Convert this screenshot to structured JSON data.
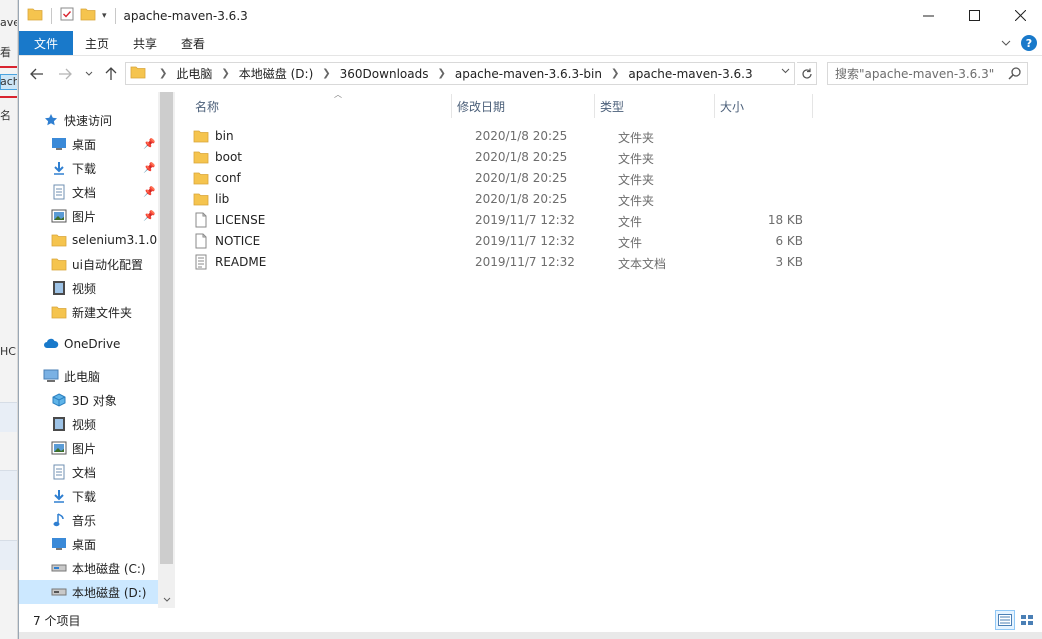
{
  "window": {
    "title": "apache-maven-3.6.3"
  },
  "ribbon": {
    "tabs": [
      "文件",
      "主页",
      "共享",
      "查看"
    ]
  },
  "address": {
    "crumbs": [
      "此电脑",
      "本地磁盘 (D:)",
      "360Downloads",
      "apache-maven-3.6.3-bin",
      "apache-maven-3.6.3"
    ]
  },
  "search": {
    "placeholder": "搜索\"apache-maven-3.6.3\""
  },
  "nav": {
    "quick_access": "快速访问",
    "quick_items": [
      {
        "label": "桌面",
        "icon": "desktop-icon",
        "pinned": true
      },
      {
        "label": "下载",
        "icon": "download-icon",
        "pinned": true
      },
      {
        "label": "文档",
        "icon": "document-icon",
        "pinned": true
      },
      {
        "label": "图片",
        "icon": "picture-icon",
        "pinned": true
      },
      {
        "label": "selenium3.1.0",
        "icon": "folder-icon",
        "pinned": false
      },
      {
        "label": "ui自动化配置",
        "icon": "folder-icon",
        "pinned": false
      },
      {
        "label": "视频",
        "icon": "video-icon",
        "pinned": false
      },
      {
        "label": "新建文件夹",
        "icon": "folder-icon",
        "pinned": false
      }
    ],
    "onedrive": "OneDrive",
    "this_pc": "此电脑",
    "pc_items": [
      {
        "label": "3D 对象",
        "icon": "cube-icon"
      },
      {
        "label": "视频",
        "icon": "video-icon"
      },
      {
        "label": "图片",
        "icon": "picture-icon"
      },
      {
        "label": "文档",
        "icon": "document-icon"
      },
      {
        "label": "下载",
        "icon": "download-icon"
      },
      {
        "label": "音乐",
        "icon": "music-icon"
      },
      {
        "label": "桌面",
        "icon": "desktop-icon"
      },
      {
        "label": "本地磁盘 (C:)",
        "icon": "drive-icon"
      },
      {
        "label": "本地磁盘 (D:)",
        "icon": "drive-icon"
      }
    ]
  },
  "columns": {
    "name": "名称",
    "date": "修改日期",
    "type": "类型",
    "size": "大小"
  },
  "files": [
    {
      "name": "bin",
      "date": "2020/1/8 20:25",
      "type": "文件夹",
      "size": "",
      "icon": "folder-icon"
    },
    {
      "name": "boot",
      "date": "2020/1/8 20:25",
      "type": "文件夹",
      "size": "",
      "icon": "folder-icon"
    },
    {
      "name": "conf",
      "date": "2020/1/8 20:25",
      "type": "文件夹",
      "size": "",
      "icon": "folder-icon"
    },
    {
      "name": "lib",
      "date": "2020/1/8 20:25",
      "type": "文件夹",
      "size": "",
      "icon": "folder-icon"
    },
    {
      "name": "LICENSE",
      "date": "2019/11/7 12:32",
      "type": "文件",
      "size": "18 KB",
      "icon": "file-icon"
    },
    {
      "name": "NOTICE",
      "date": "2019/11/7 12:32",
      "type": "文件",
      "size": "6 KB",
      "icon": "file-icon"
    },
    {
      "name": "README",
      "date": "2019/11/7 12:32",
      "type": "文本文档",
      "size": "3 KB",
      "icon": "text-file-icon"
    }
  ],
  "status": {
    "count": "7 个项目"
  },
  "background": {
    "fragments": [
      "ave",
      "看",
      "ach",
      "名",
      "HC"
    ]
  },
  "colors": {
    "accent": "#1979ca",
    "folder": "#f5c44e",
    "selection": "#cce8ff"
  }
}
